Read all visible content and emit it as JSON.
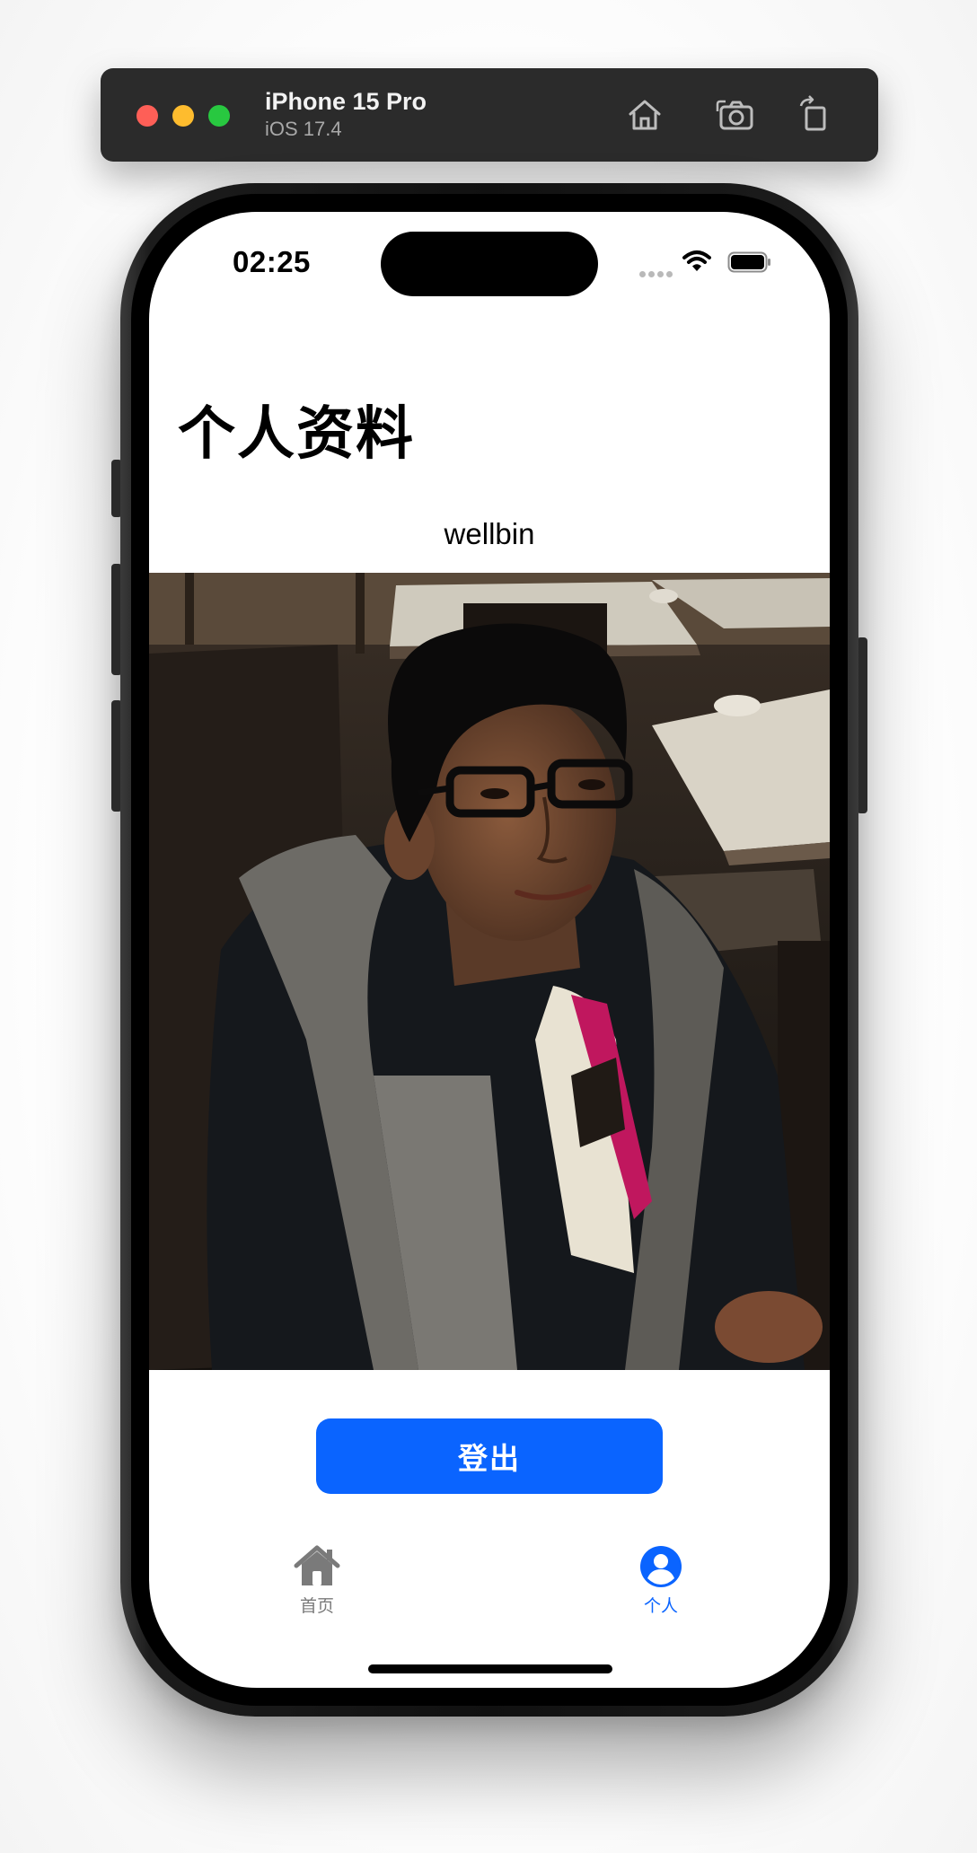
{
  "simulator": {
    "device_name": "iPhone 15 Pro",
    "os_version": "iOS 17.4",
    "icons": [
      "home-icon",
      "screenshot-icon",
      "rotate-icon"
    ]
  },
  "status_bar": {
    "time": "02:25",
    "icons": [
      "cellular-icon",
      "wifi-icon",
      "battery-icon"
    ]
  },
  "profile": {
    "title": "个人资料",
    "username": "wellbin",
    "logout_label": "登出"
  },
  "tabbar": {
    "items": [
      {
        "label": "首页",
        "icon": "house-icon",
        "selected": false
      },
      {
        "label": "个人",
        "icon": "person-circle-icon",
        "selected": true
      }
    ]
  },
  "colors": {
    "accent": "#0a64ff",
    "tab_inactive": "#7a7a7a",
    "toolbar_bg": "#2b2b2b"
  }
}
